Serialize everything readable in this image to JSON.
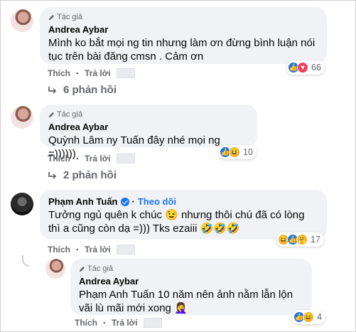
{
  "comments": [
    {
      "badge": "Tác giả",
      "author": "Andrea Aybar",
      "text": "Mình ko bắt mọi ng tin nhưng làm ơn đừng bình luận nói tục trên bài đăng cmsn . Cảm ơn",
      "actions": {
        "like": "Thích",
        "reply": "Trả lời"
      },
      "reactions": {
        "icons": [
          "like-icon",
          "love-icon"
        ],
        "count": "66"
      },
      "replies": "6 phản hồi"
    },
    {
      "badge": "Tác giả",
      "author": "Andrea Aybar",
      "mention": "Quỳnh Lâm",
      "text": " ny Tuấn đây nhé mọi ng =))))))",
      "actions": {
        "like": "Thích",
        "reply": "Trả lời"
      },
      "reactions": {
        "icons": [
          "like-icon",
          "haha-icon"
        ],
        "count": "10"
      },
      "replies": "2 phản hồi"
    },
    {
      "author": "Phạm Anh Tuấn",
      "follow": "Theo dõi",
      "text": "Tưởng ngủ quên k chúc 😉 nhưng thôi chú đã có lòng thì a cũng còn dạ =))) Tks ezaiii 🤣🤣🤣",
      "actions": {
        "like": "Thích",
        "reply": "Trả lời"
      },
      "reactions": {
        "icons": [
          "haha-icon",
          "like-icon",
          "care-icon"
        ],
        "count": "17"
      }
    },
    {
      "badge": "Tác giả",
      "author": "Andrea Aybar",
      "mention": "Phạm Anh Tuấn",
      "text": " 10 năm nên ảnh nằm lẫn lộn vãi lù mãi mới xong 🤦‍♀️",
      "actions": {
        "like": "Thích",
        "reply": "Trả lời"
      },
      "reactions": {
        "icons": [
          "like-icon",
          "haha-icon"
        ],
        "count": "4"
      }
    }
  ],
  "colors": {
    "bubble": "#f0f2f5",
    "link": "#1877f2",
    "muted": "#65676b"
  }
}
